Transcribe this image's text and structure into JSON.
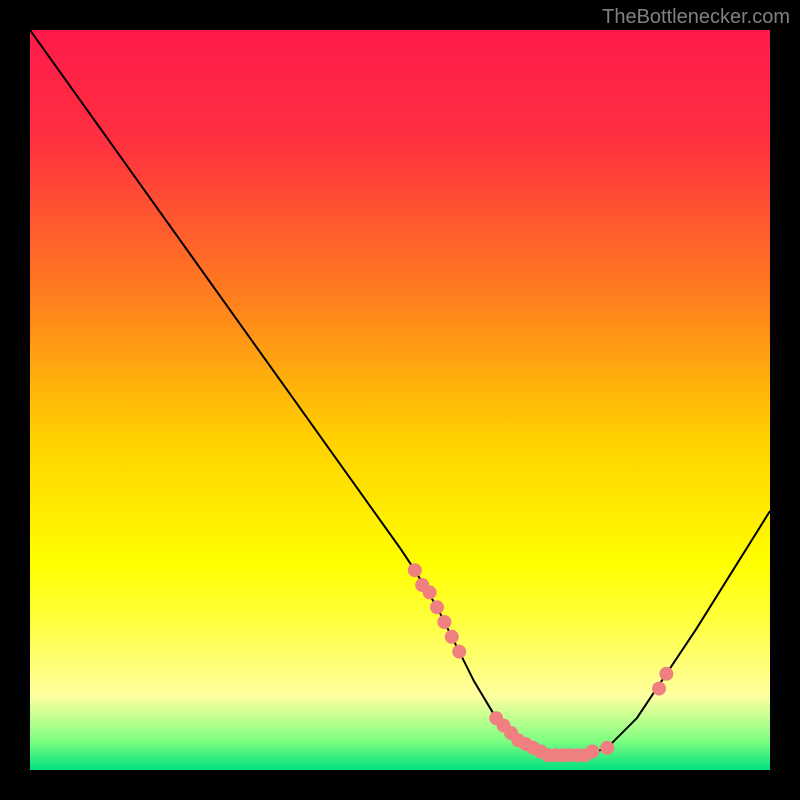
{
  "watermark": "TheBottlenecker.com",
  "chart_data": {
    "type": "line",
    "title": "",
    "xlabel": "",
    "ylabel": "",
    "xlim": [
      0,
      100
    ],
    "ylim": [
      0,
      100
    ],
    "background_gradient": {
      "stops": [
        {
          "offset": 0,
          "color": "#ff1a4a"
        },
        {
          "offset": 0.15,
          "color": "#ff3040"
        },
        {
          "offset": 0.35,
          "color": "#ff7a20"
        },
        {
          "offset": 0.55,
          "color": "#ffd000"
        },
        {
          "offset": 0.72,
          "color": "#ffff00"
        },
        {
          "offset": 0.8,
          "color": "#ffff40"
        },
        {
          "offset": 0.9,
          "color": "#ffffa0"
        },
        {
          "offset": 0.96,
          "color": "#80ff80"
        },
        {
          "offset": 1.0,
          "color": "#00e080"
        }
      ]
    },
    "curve": {
      "x": [
        0,
        5,
        10,
        15,
        20,
        25,
        30,
        35,
        40,
        45,
        50,
        52,
        55,
        58,
        60,
        63,
        65,
        68,
        70,
        72,
        75,
        78,
        82,
        86,
        90,
        95,
        100
      ],
      "y": [
        100,
        93,
        86,
        79,
        72,
        65,
        58,
        51,
        44,
        37,
        30,
        27,
        22,
        16,
        12,
        7,
        5,
        3,
        2,
        2,
        2,
        3,
        7,
        13,
        19,
        27,
        35
      ]
    },
    "markers": {
      "x": [
        52,
        53,
        54,
        55,
        56,
        57,
        58,
        63,
        64,
        65,
        66,
        67,
        68,
        69,
        70,
        71,
        72,
        73,
        74,
        75,
        76,
        78,
        85,
        86
      ],
      "y": [
        27,
        25,
        24,
        22,
        20,
        18,
        16,
        7,
        6,
        5,
        4,
        3.5,
        3,
        2.5,
        2,
        2,
        2,
        2,
        2,
        2,
        2.5,
        3,
        11,
        13
      ],
      "color": "#f08080",
      "size": 7
    }
  }
}
